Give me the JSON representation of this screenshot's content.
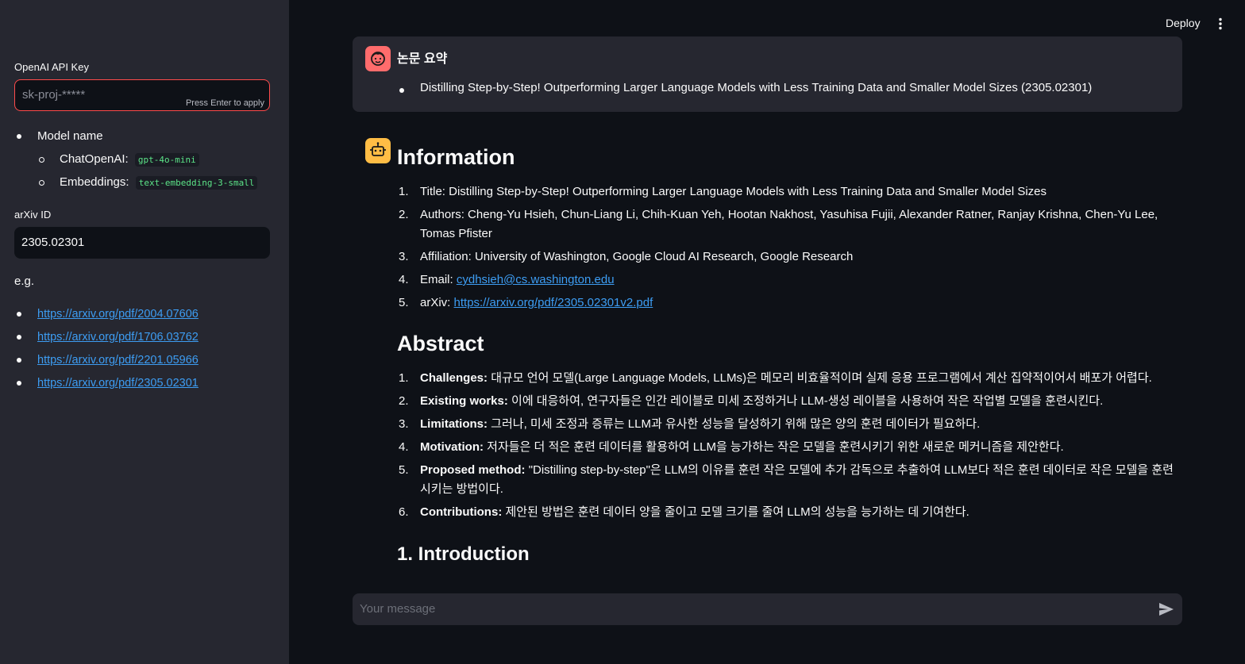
{
  "topbar": {
    "deploy_label": "Deploy"
  },
  "sidebar": {
    "api_key_label": "OpenAI API Key",
    "api_key_placeholder": "sk-proj-*****",
    "press_enter_hint": "Press Enter to apply",
    "model_name_label": "Model name",
    "chat_model_label": "ChatOpenAI:",
    "chat_model_value": "gpt-4o-mini",
    "embeddings_label": "Embeddings:",
    "embeddings_value": "text-embedding-3-small",
    "arxiv_id_label": "arXiv ID",
    "arxiv_id_value": "2305.02301",
    "examples_label": "e.g.",
    "example_links": [
      "https://arxiv.org/pdf/2004.07606",
      "https://arxiv.org/pdf/1706.03762",
      "https://arxiv.org/pdf/2201.05966",
      "https://arxiv.org/pdf/2305.02301"
    ]
  },
  "user_message": {
    "title": "논문 요약",
    "item": "Distilling Step-by-Step! Outperforming Larger Language Models with Less Training Data and Smaller Model Sizes (2305.02301)"
  },
  "assistant_message": {
    "information_heading": "Information",
    "info_items": [
      {
        "num": "1.",
        "label": "Title:",
        "text": "Distilling Step-by-Step! Outperforming Larger Language Models with Less Training Data and Smaller Model Sizes"
      },
      {
        "num": "2.",
        "label": "Authors:",
        "text": "Cheng-Yu Hsieh, Chun-Liang Li, Chih-Kuan Yeh, Hootan Nakhost, Yasuhisa Fujii, Alexander Ratner, Ranjay Krishna, Chen-Yu Lee, Tomas Pfister"
      },
      {
        "num": "3.",
        "label": "Affiliation:",
        "text": "University of Washington, Google Cloud AI Research, Google Research"
      },
      {
        "num": "4.",
        "label": "Email:",
        "link": "cydhsieh@cs.washington.edu"
      },
      {
        "num": "5.",
        "label": "arXiv:",
        "link": "https://arxiv.org/pdf/2305.02301v2.pdf"
      }
    ],
    "abstract_heading": "Abstract",
    "abstract_items": [
      {
        "num": "1.",
        "label": "Challenges:",
        "text": "대규모 언어 모델(Large Language Models, LLMs)은 메모리 비효율적이며 실제 응용 프로그램에서 계산 집약적이어서 배포가 어렵다."
      },
      {
        "num": "2.",
        "label": "Existing works:",
        "text": "이에 대응하여, 연구자들은 인간 레이블로 미세 조정하거나 LLM-생성 레이블을 사용하여 작은 작업별 모델을 훈련시킨다."
      },
      {
        "num": "3.",
        "label": "Limitations:",
        "text": "그러나, 미세 조정과 증류는 LLM과 유사한 성능을 달성하기 위해 많은 양의 훈련 데이터가 필요하다."
      },
      {
        "num": "4.",
        "label": "Motivation:",
        "text": "저자들은 더 적은 훈련 데이터를 활용하여 LLM을 능가하는 작은 모델을 훈련시키기 위한 새로운 메커니즘을 제안한다."
      },
      {
        "num": "5.",
        "label": "Proposed method:",
        "text": "\"Distilling step-by-step\"은 LLM의 이유를 훈련 작은 모델에 추가 감독으로 추출하여 LLM보다 적은 훈련 데이터로 작은 모델을 훈련시키는 방법이다."
      },
      {
        "num": "6.",
        "label": "Contributions:",
        "text": "제안된 방법은 훈련 데이터 양을 줄이고 모델 크기를 줄여 LLM의 성능을 능가하는 데 기여한다."
      }
    ],
    "next_heading": "1. Introduction"
  },
  "chat_input": {
    "placeholder": "Your message"
  },
  "icons": {
    "user_avatar": "face-icon",
    "bot_avatar": "robot-icon",
    "send": "send-icon",
    "menu": "kebab-menu-icon"
  },
  "colors": {
    "app_bg": "#0e1117",
    "sidebar_bg": "#262730",
    "user_avatar": "#ff6c6c",
    "bot_avatar": "#ffbd45",
    "link": "#3d9df3",
    "code": "#5ce488",
    "input_border_active": "#ff4b4b"
  }
}
